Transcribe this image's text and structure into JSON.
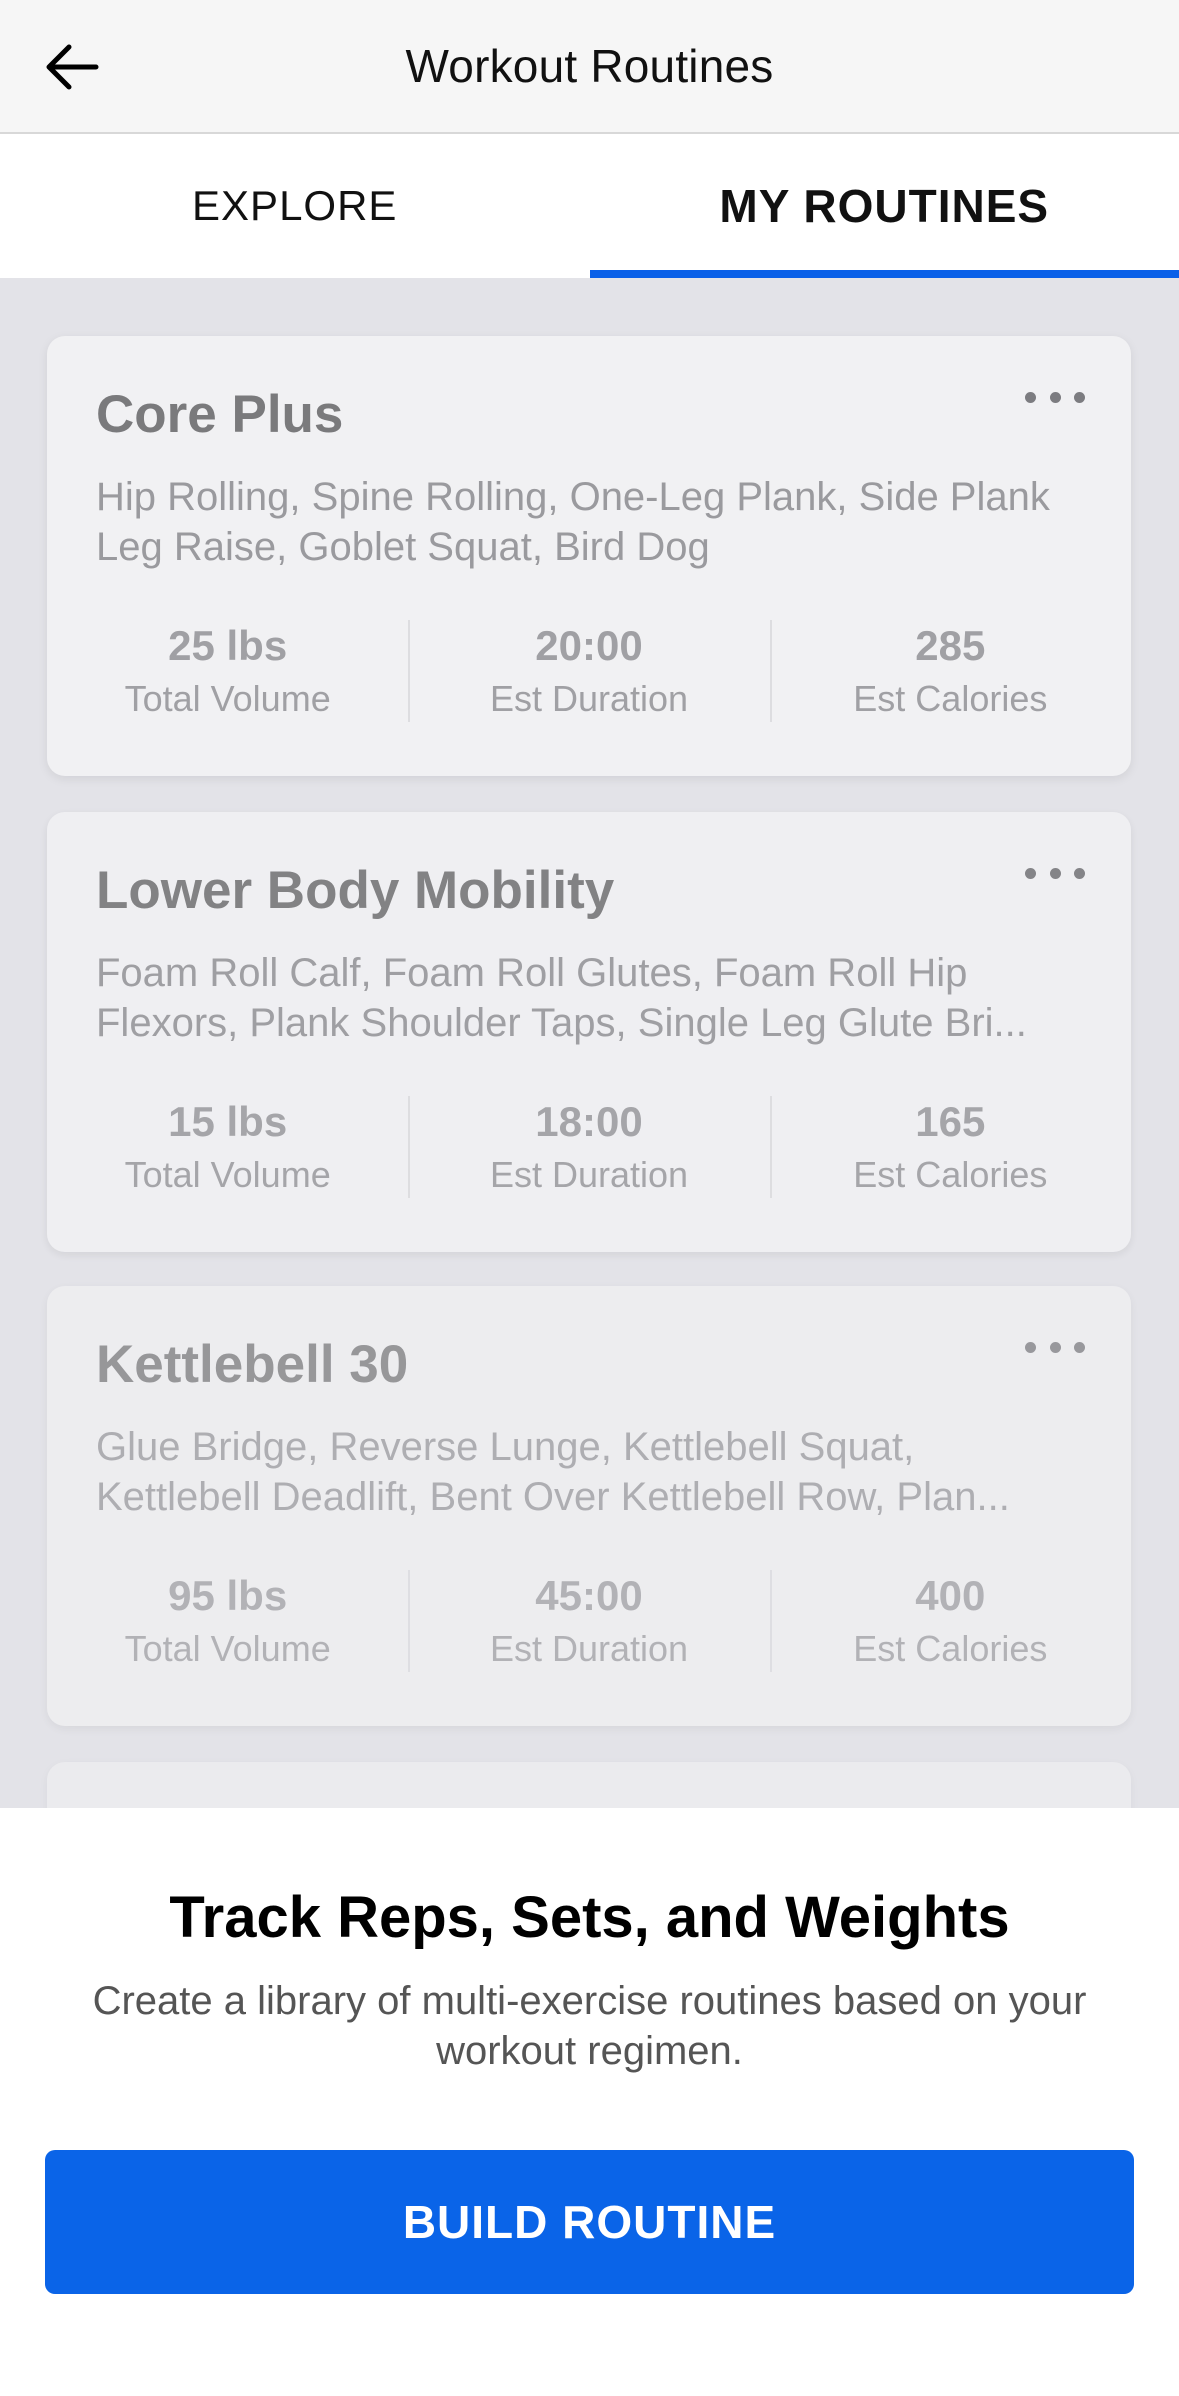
{
  "header": {
    "title": "Workout Routines",
    "back_icon": "arrow-left-icon"
  },
  "tabs": [
    {
      "label": "EXPLORE",
      "active": false
    },
    {
      "label": "MY ROUTINES",
      "active": true
    }
  ],
  "colors": {
    "accent": "#0a64e8",
    "background": "#e3e3e8"
  },
  "routines": [
    {
      "title": "Core Plus",
      "exercises": "Hip Rolling, Spine Rolling, One-Leg Plank, Side Plank Leg Raise, Goblet Squat, Bird Dog",
      "stats": [
        {
          "value": "25 lbs",
          "label": "Total Volume"
        },
        {
          "value": "20:00",
          "label": "Est Duration"
        },
        {
          "value": "285",
          "label": "Est Calories"
        }
      ]
    },
    {
      "title": "Lower Body Mobility",
      "exercises": "Foam Roll Calf, Foam Roll Glutes, Foam Roll Hip Flexors, Plank Shoulder Taps, Single Leg Glute Bri...",
      "stats": [
        {
          "value": "15 lbs",
          "label": "Total Volume"
        },
        {
          "value": "18:00",
          "label": "Est Duration"
        },
        {
          "value": "165",
          "label": "Est Calories"
        }
      ]
    },
    {
      "title": "Kettlebell 30",
      "exercises": "Glue Bridge, Reverse Lunge, Kettlebell Squat, Kettlebell Deadlift, Bent Over Kettlebell Row, Plan...",
      "stats": [
        {
          "value": "95 lbs",
          "label": "Total Volume"
        },
        {
          "value": "45:00",
          "label": "Est Duration"
        },
        {
          "value": "400",
          "label": "Est Calories"
        }
      ]
    }
  ],
  "promo": {
    "title": "Track Reps, Sets, and Weights",
    "text": "Create a library of multi-exercise routines based on your workout regimen.",
    "button_label": "BUILD ROUTINE"
  }
}
